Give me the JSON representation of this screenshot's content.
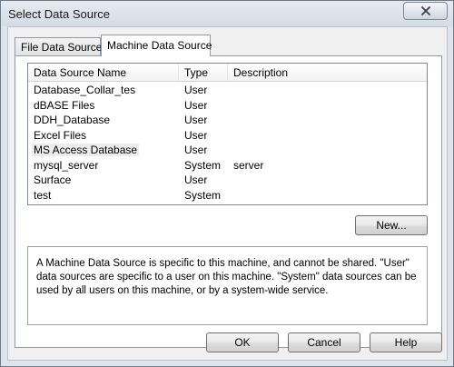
{
  "window": {
    "title": "Select Data Source"
  },
  "tabs": [
    {
      "label": "File Data Source",
      "active": false
    },
    {
      "label": "Machine Data Source",
      "active": true
    }
  ],
  "listview": {
    "columns": [
      "Data Source Name",
      "Type",
      "Description"
    ],
    "rows": [
      {
        "name": "Database_Collar_tes",
        "type": "User",
        "description": ""
      },
      {
        "name": "dBASE Files",
        "type": "User",
        "description": ""
      },
      {
        "name": "DDH_Database",
        "type": "User",
        "description": ""
      },
      {
        "name": "Excel Files",
        "type": "User",
        "description": ""
      },
      {
        "name": "MS Access Database",
        "type": "User",
        "description": "",
        "selected": true
      },
      {
        "name": "mysql_server",
        "type": "System",
        "description": "server"
      },
      {
        "name": "Surface",
        "type": "User",
        "description": ""
      },
      {
        "name": "test",
        "type": "System",
        "description": ""
      }
    ]
  },
  "buttons": {
    "new": "New...",
    "ok": "OK",
    "cancel": "Cancel",
    "help": "Help"
  },
  "description": "A Machine Data Source is specific to this machine, and cannot be shared.  \"User\" data sources are specific to a user on this machine.  \"System\" data sources can be used by all users on this machine, or by a system-wide service.",
  "icons": {
    "close": "close-icon"
  },
  "colors": {
    "window_frame": "#dfe4ea",
    "client_bg": "#f0f0f0",
    "panel_bg": "#ffffff"
  }
}
